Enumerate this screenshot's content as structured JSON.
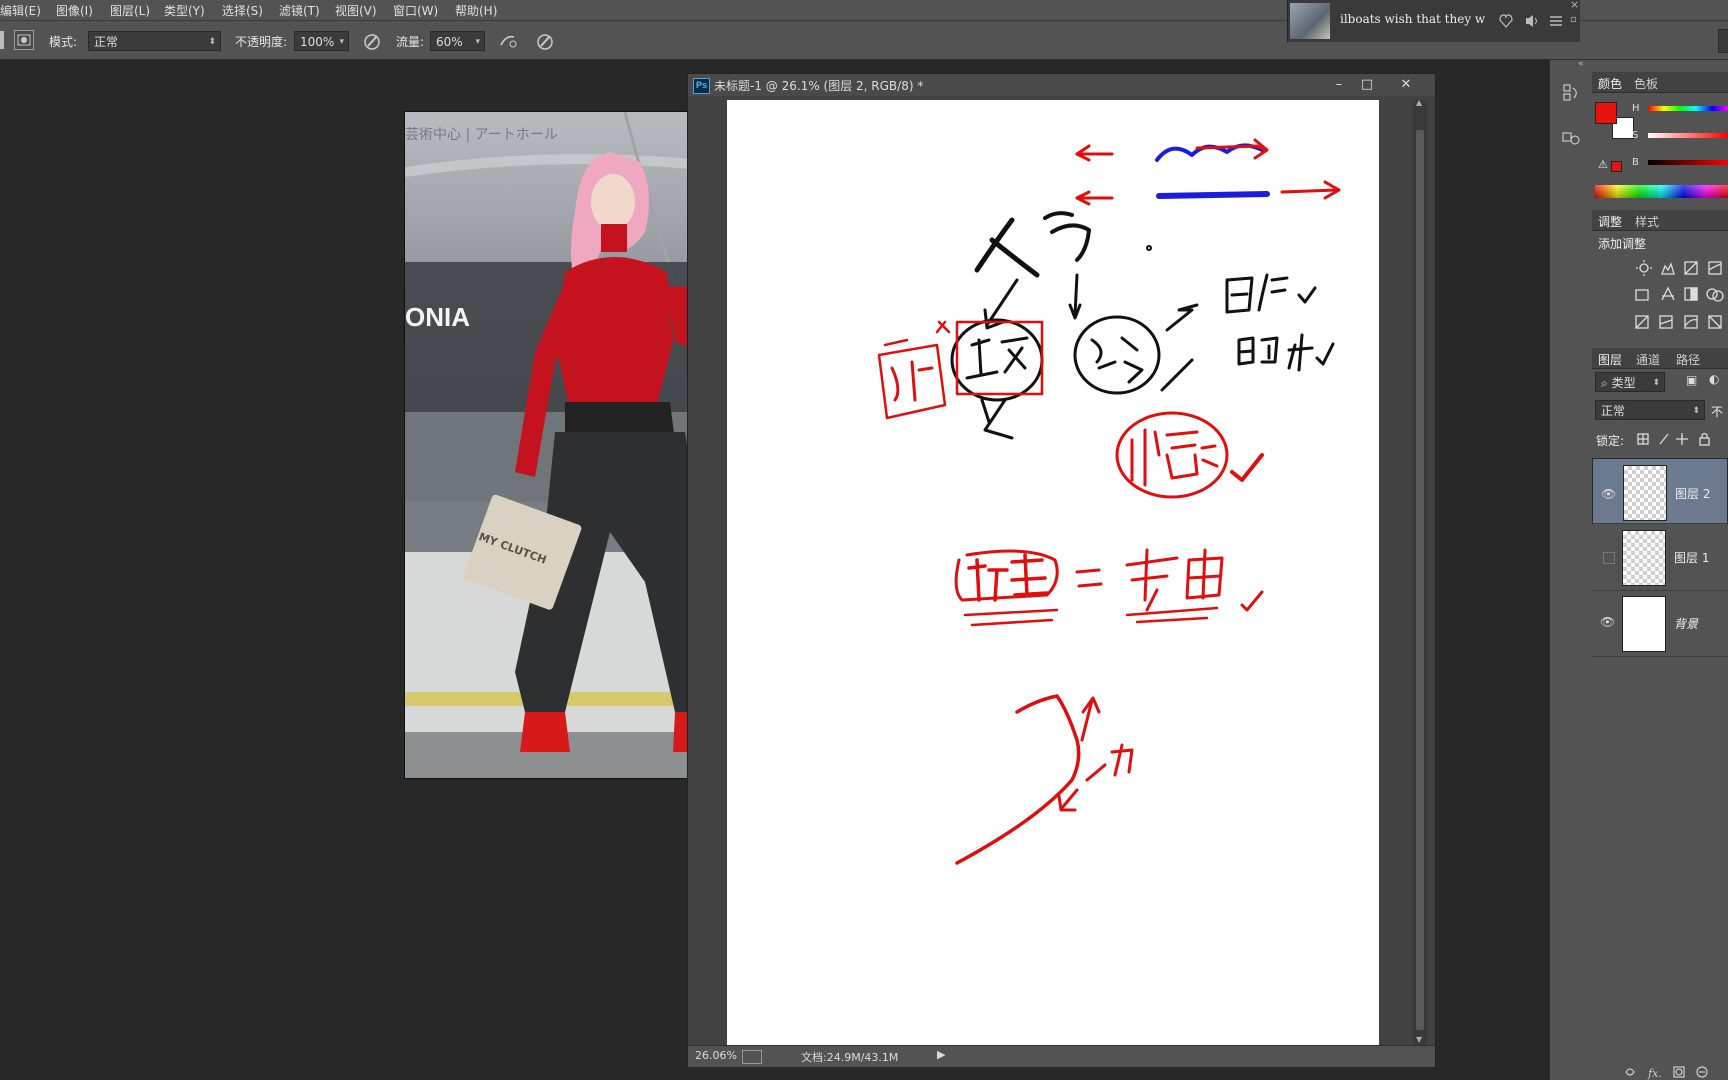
{
  "menu": [
    "编辑(E)",
    "图像(I)",
    "图层(L)",
    "类型(Y)",
    "选择(S)",
    "滤镜(T)",
    "视图(V)",
    "窗口(W)",
    "帮助(H)"
  ],
  "options": {
    "mode_label": "模式:",
    "mode_value": "正常",
    "opacity_label": "不透明度:",
    "opacity_value": "100%",
    "flow_label": "流量:",
    "flow_value": "60%"
  },
  "player": {
    "title": "ilboats wish that they w"
  },
  "reference_photo": {
    "storefront_text": "ONIA",
    "sign_text": "芸術中心 | アートホール",
    "clutch_text": "MY CLUTCH"
  },
  "document": {
    "title": "未标题-1 @ 26.1% (图层 2, RGB/8) *",
    "ps_badge": "Ps",
    "zoom": "26.06%",
    "doc_size": "文档:24.9M/43.1M"
  },
  "colors": {
    "foreground": "#e8120f",
    "background": "#ffffff",
    "ink_red": "#e10e0e",
    "ink_blue": "#1c1ce0",
    "ink_black": "#111111"
  },
  "panels": {
    "color_tabs": [
      "颜色",
      "色板"
    ],
    "hsb_labels": [
      "H",
      "S",
      "B"
    ],
    "adjust_tabs": [
      "调整",
      "样式"
    ],
    "adjust_title": "添加调整",
    "layers_tabs": [
      "图层",
      "通道",
      "路径"
    ],
    "filter_kind": "类型",
    "blend_mode": "正常",
    "opacity_short": "不",
    "lock_label": "锁定:",
    "layers": [
      {
        "name": "图层 2",
        "visible": true,
        "selected": true
      },
      {
        "name": "图层 1",
        "visible": false,
        "selected": false
      },
      {
        "name": "背景",
        "visible": true,
        "selected": false
      }
    ]
  },
  "annotations": {
    "figure": "人物",
    "direct": "直接",
    "sequence": "记忆",
    "line": "线条",
    "painting": "画作",
    "photo": "照片",
    "copy": "临摹",
    "fold": "折挂",
    "equals": "=",
    "bend": "弯曲",
    "force": "力"
  }
}
